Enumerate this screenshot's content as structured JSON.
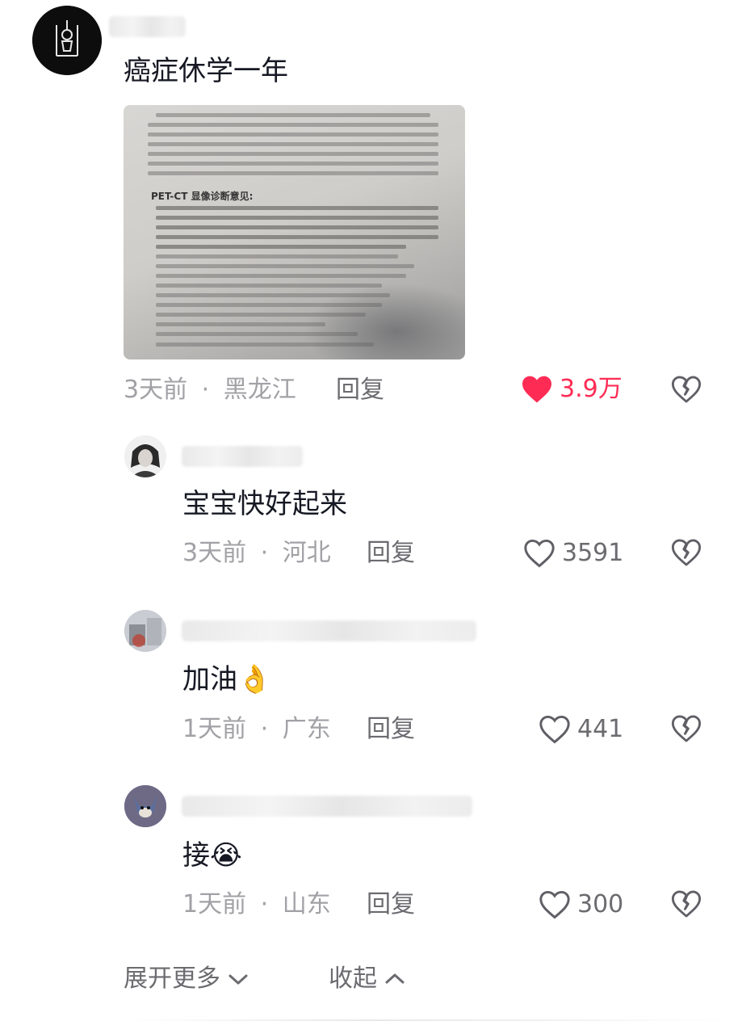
{
  "comments": [
    {
      "text": "癌症休学一年",
      "time": "3天前",
      "region": "黑龙江",
      "reply": "回复",
      "likes": "3.9万",
      "liked": true,
      "has_image": true,
      "image_heading": "PET-CT 显像诊断意见:"
    },
    {
      "text": "宝宝快好起来",
      "time": "3天前",
      "region": "河北",
      "reply": "回复",
      "likes": "3591",
      "liked": false
    },
    {
      "text": "加油",
      "emoji": "👌",
      "time": "1天前",
      "region": "广东",
      "reply": "回复",
      "likes": "441",
      "liked": false
    },
    {
      "text": "接",
      "emoji": "😭",
      "time": "1天前",
      "region": "山东",
      "reply": "回复",
      "likes": "300",
      "liked": false
    }
  ],
  "separator": "·",
  "footer": {
    "expand_label": "展开更多",
    "collapse_label": "收起"
  },
  "colors": {
    "like_active": "#fe2c55",
    "meta_text": "#a1a1a6",
    "primary_text": "#161823"
  },
  "icons": [
    "heart-icon",
    "broken-heart-icon",
    "chevron-down-icon",
    "chevron-up-icon"
  ]
}
